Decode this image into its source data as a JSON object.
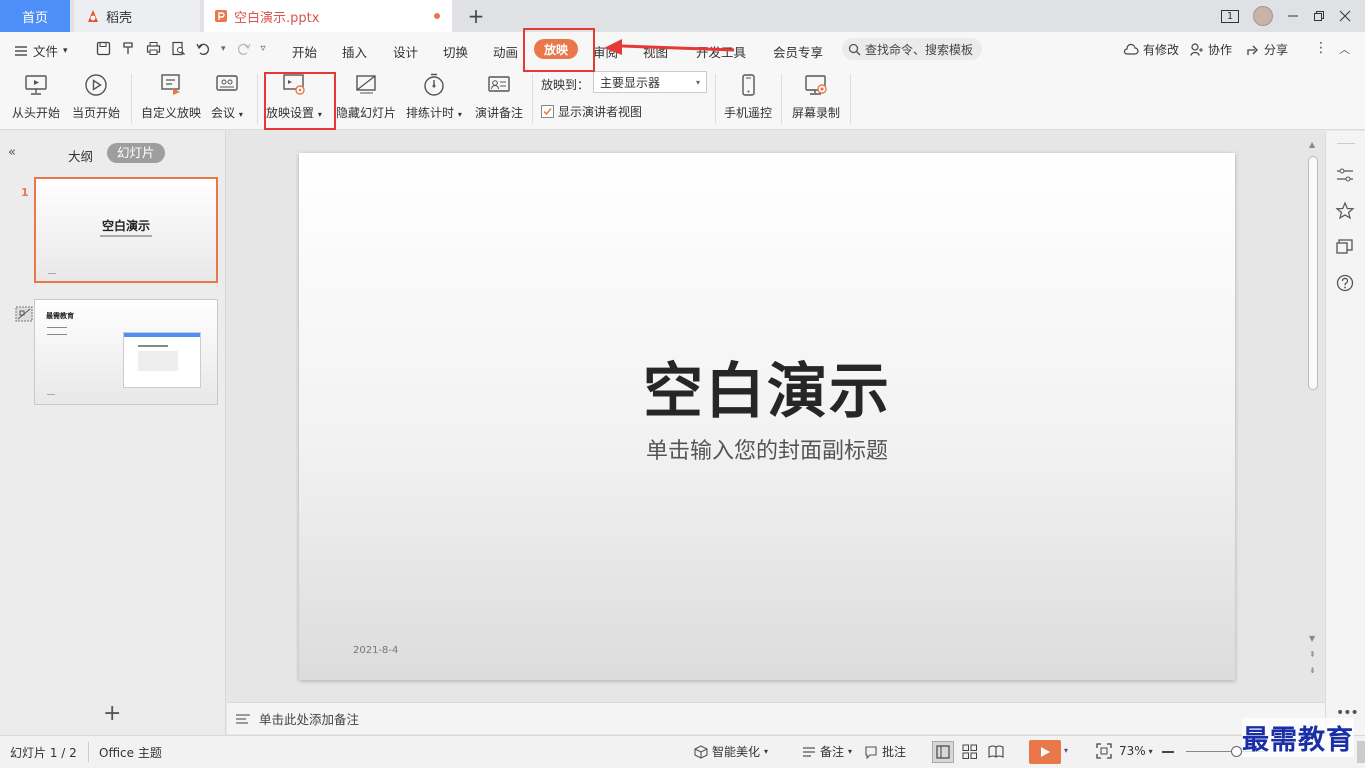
{
  "tabs": {
    "home": "首页",
    "daoke": "稻壳",
    "file": "空白演示.pptx",
    "badge": "1"
  },
  "menu": {
    "file": "文件",
    "items": [
      "开始",
      "插入",
      "设计",
      "切换",
      "动画",
      "放映",
      "审阅",
      "视图",
      "开发工具",
      "会员专享"
    ],
    "search_placeholder": "查找命令、搜索模板",
    "right": {
      "changes": "有修改",
      "collab": "协作",
      "share": "分享"
    }
  },
  "toolbar": {
    "from_start": "从头开始",
    "from_current": "当页开始",
    "custom_show": "自定义放映",
    "meeting": "会议",
    "show_settings": "放映设置",
    "hide_slide": "隐藏幻灯片",
    "rehearse": "排练计时",
    "speaker_notes": "演讲备注",
    "show_to_label": "放映到：",
    "show_to_value": "主要显示器",
    "presenter_view": "显示演讲者视图",
    "phone_remote": "手机遥控",
    "screen_record": "屏幕录制"
  },
  "left_panel": {
    "outline_tab": "大纲",
    "slides_tab": "幻灯片",
    "slide1_num": "1",
    "slide1_title": "空白演示",
    "slide2_title": "最需教育"
  },
  "slide": {
    "title": "空白演示",
    "subtitle": "单击输入您的封面副标题",
    "date": "2021-8-4"
  },
  "notes": {
    "placeholder": "单击此处添加备注"
  },
  "status": {
    "slide_count": "幻灯片 1 / 2",
    "theme": "Office 主题",
    "smart": "智能美化",
    "notes": "备注",
    "comments": "批注",
    "zoom": "73%"
  },
  "watermark": "最需教育",
  "colors": {
    "accent": "#e8774a",
    "annotation": "#e53935",
    "home_tab": "#4d8ef7"
  }
}
